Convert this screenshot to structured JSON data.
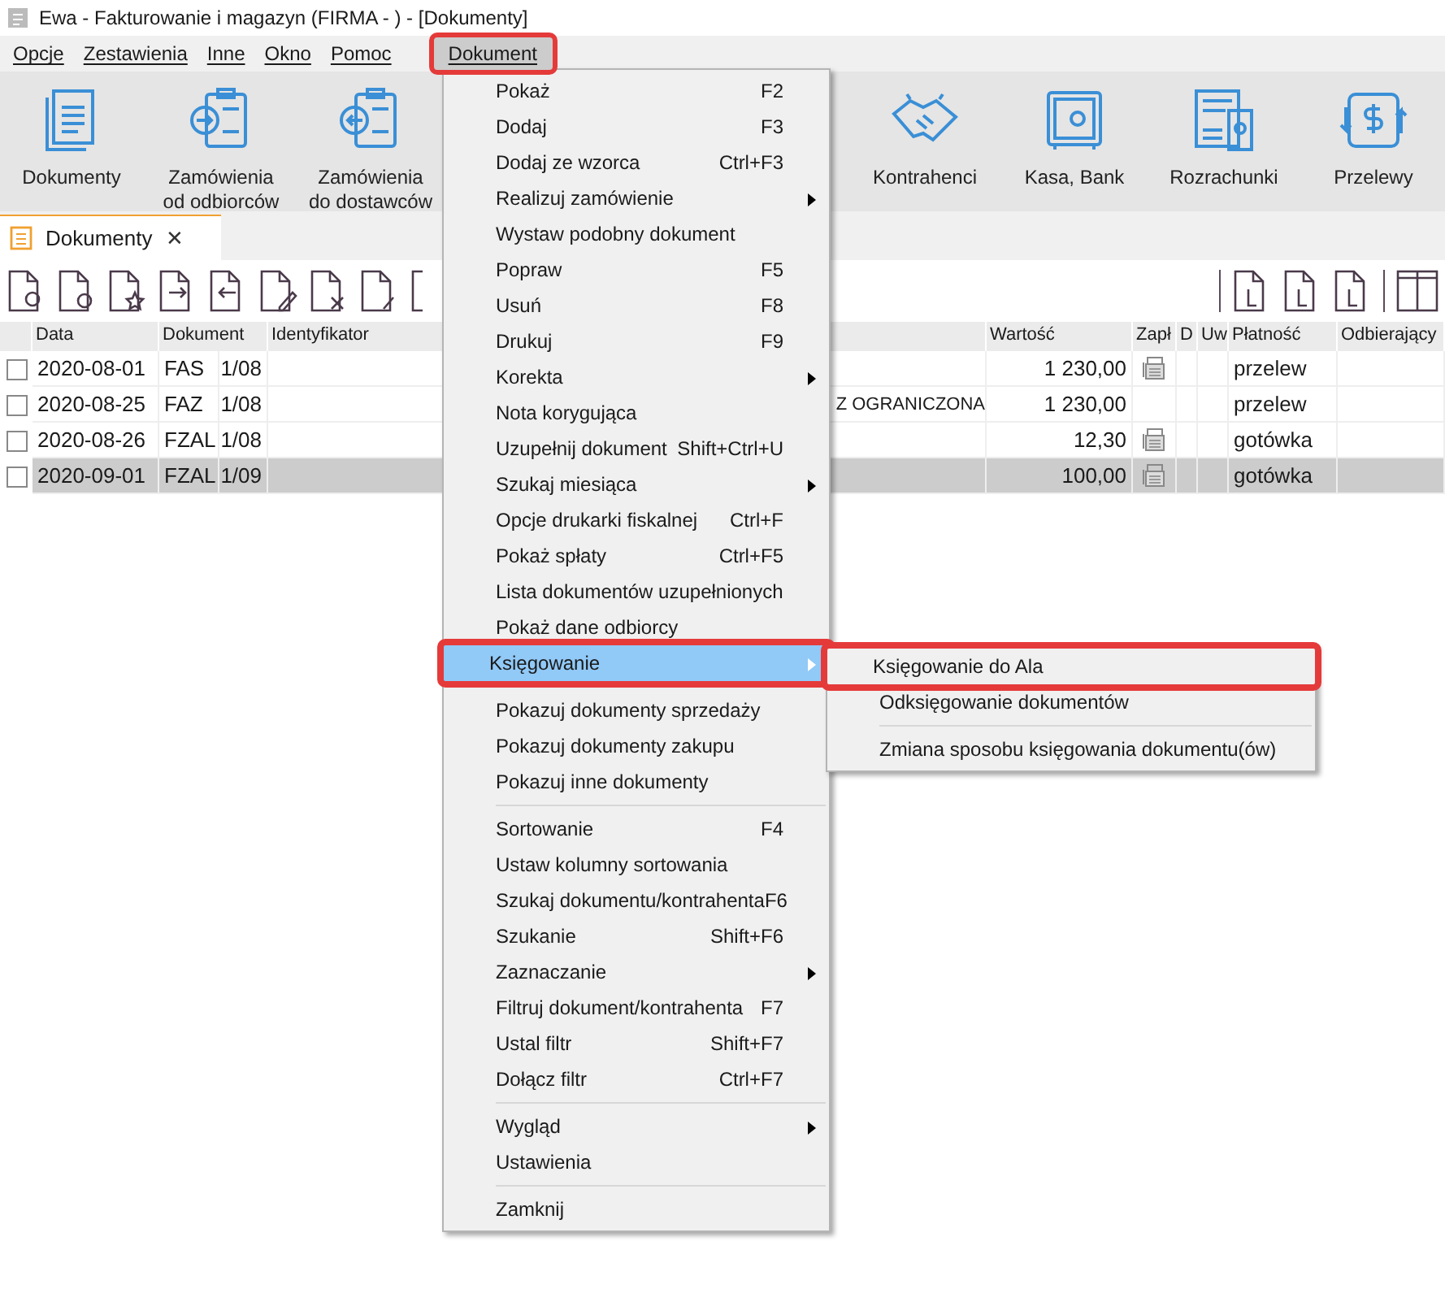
{
  "window": {
    "title": "Ewa - Fakturowanie i magazyn (FIRMA - ) - [Dokumenty]"
  },
  "menubar": [
    {
      "label": "Opcje",
      "selected": false,
      "annotated": false
    },
    {
      "label": "Zestawienia",
      "selected": false,
      "annotated": false
    },
    {
      "label": "Inne",
      "selected": false,
      "annotated": false
    },
    {
      "label": "Okno",
      "selected": false,
      "annotated": false
    },
    {
      "label": "Pomoc",
      "selected": false,
      "annotated": false
    },
    {
      "label": "Dokument",
      "selected": true,
      "annotated": true
    }
  ],
  "ribbon": {
    "left": [
      {
        "label": "Dokumenty"
      },
      {
        "label": "Zamówienia\nod odbiorców"
      },
      {
        "label": "Zamówienia\ndo dostawców"
      }
    ],
    "right": [
      {
        "label": "Kontrahenci"
      },
      {
        "label": "Kasa, Bank"
      },
      {
        "label": "Rozrachunki"
      },
      {
        "label": "Przelewy"
      }
    ]
  },
  "tabs": [
    {
      "label": "Dokumenty",
      "selected": true,
      "close": "✕"
    }
  ],
  "table": {
    "columns": [
      "Data",
      "Dokument",
      "Identyfikator",
      "Wartość",
      "Zapł",
      "D",
      "Uw",
      "Płatność",
      "Odbierający"
    ],
    "rows": [
      {
        "checked": false,
        "selected": false,
        "date": "2020-08-01",
        "doc_type": "FAS",
        "doc_number": "1/08",
        "value": "1 230,00",
        "printed": true,
        "payment": "przelew"
      },
      {
        "checked": false,
        "selected": false,
        "date": "2020-08-25",
        "doc_type": "FAZ",
        "doc_number": "1/08",
        "column_4": "Z OGRANICZONA",
        "value": "1 230,00",
        "printed": false,
        "payment": "przelew"
      },
      {
        "checked": false,
        "selected": false,
        "date": "2020-08-26",
        "doc_type": "FZAL",
        "doc_number": "1/08",
        "value": "12,30",
        "printed": true,
        "payment": "gotówka"
      },
      {
        "checked": false,
        "selected": true,
        "date": "2020-09-01",
        "doc_type": "FZAL",
        "doc_number": "1/09",
        "value": "100,00",
        "printed": true,
        "payment": "gotówka"
      }
    ]
  },
  "menu": {
    "groups": [
      [
        {
          "label": "Pokaż",
          "shortcut": "F2",
          "submenu": false,
          "selected": false,
          "annotated": false
        },
        {
          "label": "Dodaj",
          "shortcut": "F3",
          "submenu": false,
          "selected": false,
          "annotated": false
        },
        {
          "label": "Dodaj ze wzorca",
          "shortcut": "Ctrl+F3",
          "submenu": false,
          "selected": false,
          "annotated": false
        },
        {
          "label": "Realizuj zamówienie",
          "submenu": true,
          "selected": false,
          "annotated": false
        },
        {
          "label": "Wystaw podobny dokument",
          "submenu": false,
          "selected": false,
          "annotated": false
        },
        {
          "label": "Popraw",
          "shortcut": "F5",
          "submenu": false,
          "selected": false,
          "annotated": false
        },
        {
          "label": "Usuń",
          "shortcut": "F8",
          "submenu": false,
          "selected": false,
          "annotated": false
        },
        {
          "label": "Drukuj",
          "shortcut": "F9",
          "submenu": false,
          "selected": false,
          "annotated": false
        },
        {
          "label": "Korekta",
          "submenu": true,
          "selected": false,
          "annotated": false
        },
        {
          "label": "Nota korygująca",
          "submenu": false,
          "selected": false,
          "annotated": false
        },
        {
          "label": "Uzupełnij dokument",
          "shortcut": "Shift+Ctrl+U",
          "submenu": false,
          "selected": false,
          "annotated": false
        },
        {
          "label": "Szukaj miesiąca",
          "submenu": true,
          "selected": false,
          "annotated": false
        },
        {
          "label": "Opcje drukarki fiskalnej",
          "shortcut": "Ctrl+F",
          "submenu": false,
          "selected": false,
          "annotated": false
        },
        {
          "label": "Pokaż spłaty",
          "shortcut": "Ctrl+F5",
          "submenu": false,
          "selected": false,
          "annotated": false
        },
        {
          "label": "Lista dokumentów uzupełnionych",
          "submenu": false,
          "selected": false,
          "annotated": false
        },
        {
          "label": "Pokaż dane odbiorcy",
          "submenu": false,
          "selected": false,
          "annotated": false
        },
        {
          "label": "Księgowanie",
          "submenu": true,
          "selected": true,
          "annotated": true
        }
      ],
      [
        {
          "label": "Pokazuj dokumenty sprzedaży",
          "submenu": false,
          "selected": false,
          "annotated": false
        },
        {
          "label": "Pokazuj dokumenty zakupu",
          "submenu": false,
          "selected": false,
          "annotated": false
        },
        {
          "label": "Pokazuj inne dokumenty",
          "submenu": false,
          "selected": false,
          "annotated": false
        }
      ],
      [
        {
          "label": "Sortowanie",
          "shortcut": "F4",
          "submenu": false,
          "selected": false,
          "annotated": false
        },
        {
          "label": "Ustaw kolumny sortowania",
          "submenu": false,
          "selected": false,
          "annotated": false
        },
        {
          "label": "Szukaj dokumentu/kontrahenta",
          "shortcut": "F6",
          "submenu": false,
          "selected": false,
          "annotated": false
        },
        {
          "label": "Szukanie",
          "shortcut": "Shift+F6",
          "submenu": false,
          "selected": false,
          "annotated": false
        },
        {
          "label": "Zaznaczanie",
          "submenu": true,
          "selected": false,
          "annotated": false
        },
        {
          "label": "Filtruj dokument/kontrahenta",
          "shortcut": "F7",
          "submenu": false,
          "selected": false,
          "annotated": false
        },
        {
          "label": "Ustal filtr",
          "shortcut": "Shift+F7",
          "submenu": false,
          "selected": false,
          "annotated": false
        },
        {
          "label": "Dołącz filtr",
          "shortcut": "Ctrl+F7",
          "submenu": false,
          "selected": false,
          "annotated": false
        }
      ],
      [
        {
          "label": "Wygląd",
          "submenu": true,
          "selected": false,
          "annotated": false
        },
        {
          "label": "Ustawienia",
          "submenu": false,
          "selected": false,
          "annotated": false
        }
      ],
      [
        {
          "label": "Zamknij",
          "submenu": false,
          "selected": false,
          "annotated": false
        }
      ]
    ]
  },
  "submenu": {
    "groups": [
      [
        {
          "label": "Księgowanie do Ala",
          "selected": false,
          "annotated": true
        },
        {
          "label": "Odksięgowanie dokumentów",
          "selected": false,
          "annotated": false
        }
      ],
      [
        {
          "label": "Zmiana sposobu księgowania dokumentu(ów)",
          "selected": false,
          "annotated": false
        }
      ]
    ]
  }
}
